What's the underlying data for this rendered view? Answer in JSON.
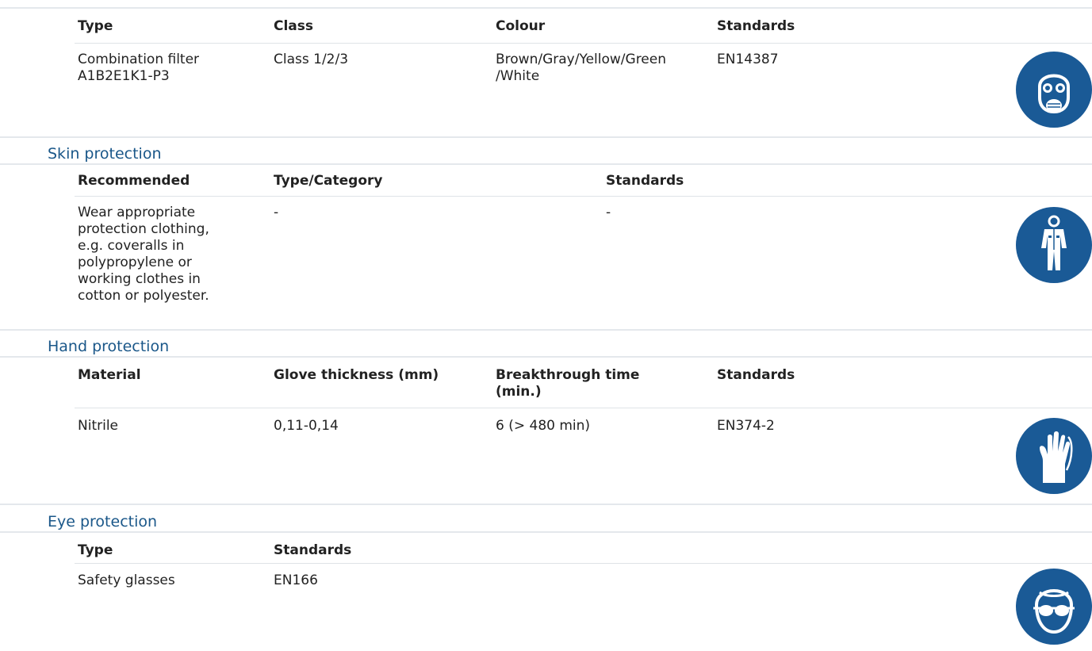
{
  "respiratory": {
    "headers": [
      "Type",
      "Class",
      "Colour",
      "Standards"
    ],
    "row": {
      "type_line1": "Combination filter",
      "type_line2": "A1B2E1K1-P3",
      "class": "Class 1/2/3",
      "colour_line1": "Brown/Gray/Yellow/Green",
      "colour_line2": "/White",
      "standards": "EN14387"
    },
    "icon": "respirator-mask-icon"
  },
  "skin": {
    "title": "Skin protection",
    "headers": [
      "Recommended",
      "Type/Category",
      "Standards"
    ],
    "row": {
      "recommended_lines": [
        "Wear appropriate",
        "protection clothing,",
        "e.g. coveralls in",
        "polypropylene or",
        "working clothes in",
        "cotton or polyester."
      ],
      "type_category": "-",
      "standards": "-"
    },
    "icon": "protective-coverall-icon"
  },
  "hand": {
    "title": "Hand protection",
    "headers": {
      "material": "Material",
      "thickness": "Glove thickness (mm)",
      "breakthrough_line1": "Breakthrough time",
      "breakthrough_line2": "(min.)",
      "standards": "Standards"
    },
    "row": {
      "material": "Nitrile",
      "thickness": "0,11-0,14",
      "breakthrough": "6 (> 480 min)",
      "standards": "EN374-2"
    },
    "icon": "glove-icon"
  },
  "eye": {
    "title": "Eye protection",
    "headers": [
      "Type",
      "Standards"
    ],
    "row": {
      "type": "Safety glasses",
      "standards": "EN166"
    },
    "icon": "safety-glasses-icon"
  },
  "colors": {
    "section_title": "#1a5789",
    "icon_blue": "#1a5a96",
    "rule": "#dfe3e7"
  }
}
